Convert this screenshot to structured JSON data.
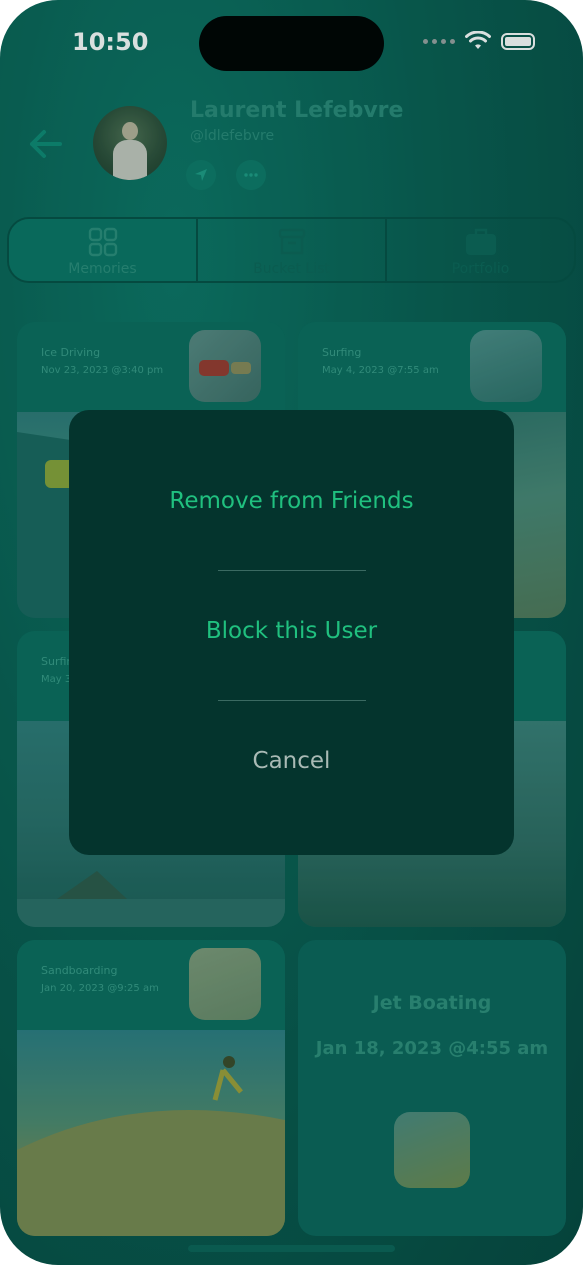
{
  "status_bar": {
    "time": "10:50"
  },
  "profile": {
    "name": "Laurent Lefebvre",
    "handle": "@ldlefebvre",
    "icons": [
      "back-arrow-icon",
      "send-icon",
      "more-icon"
    ]
  },
  "tabs": [
    {
      "label": "Memories",
      "icon": "grid-icon",
      "active": true
    },
    {
      "label": "Bucket List",
      "icon": "archive-icon",
      "active": false
    },
    {
      "label": "Portfolio",
      "icon": "suitcase-icon",
      "active": false
    }
  ],
  "cards": [
    {
      "title": "Ice Driving",
      "date": "Nov 23, 2023 @3:40 pm"
    },
    {
      "title": "Surfing",
      "date": "May 4, 2023 @7:55 am"
    },
    {
      "title": "Surfin",
      "date": "May 3"
    },
    {
      "title": "Sandboarding",
      "date": "Jan 20, 2023 @9:25 am"
    },
    {
      "title": "Jet Boating",
      "date": "Jan 18, 2023 @4:55 am"
    }
  ],
  "action_sheet": {
    "remove_label": "Remove from Friends",
    "block_label": "Block this User",
    "cancel_label": "Cancel"
  },
  "colors": {
    "accent": "#20c07f",
    "background": "#0a5e52",
    "modal": "#04342d"
  }
}
